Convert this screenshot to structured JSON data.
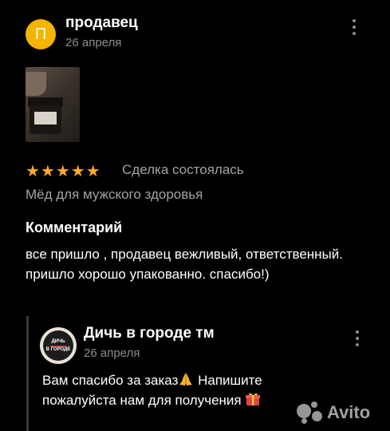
{
  "review": {
    "avatar_letter": "П",
    "author": "продавец",
    "date": "26 апреля",
    "stars": "★★★★★",
    "rating": 5,
    "deal_status": "Сделка состоялась",
    "product": "Мёд для мужского здоровья",
    "comment_heading": "Комментарий",
    "comment_text": "все пришло , продавец вежливый, ответственный. пришло хорошо упакованно. спасибо!)"
  },
  "reply": {
    "author": "Дичь в городе тм",
    "date": "26 апреля",
    "logo_text_1": "ДИЧЬ",
    "logo_text_2": "В ГОРОДЕ",
    "text_line_1": "Вам спасибо за заказ",
    "text_line_1_tail": " Напишите",
    "text_line_2": "пожалуйста нам для получения "
  },
  "watermark": {
    "text": "Avito"
  },
  "colors": {
    "background": "#000000",
    "avatar": "#f4b400",
    "star": "#ffa928",
    "muted": "#a3a3a3",
    "date": "#8c8c8c"
  },
  "icons": [
    "more-vertical-icon",
    "star-icon",
    "praying-hands-emoji",
    "gift-emoji",
    "avito-logo-icon"
  ]
}
